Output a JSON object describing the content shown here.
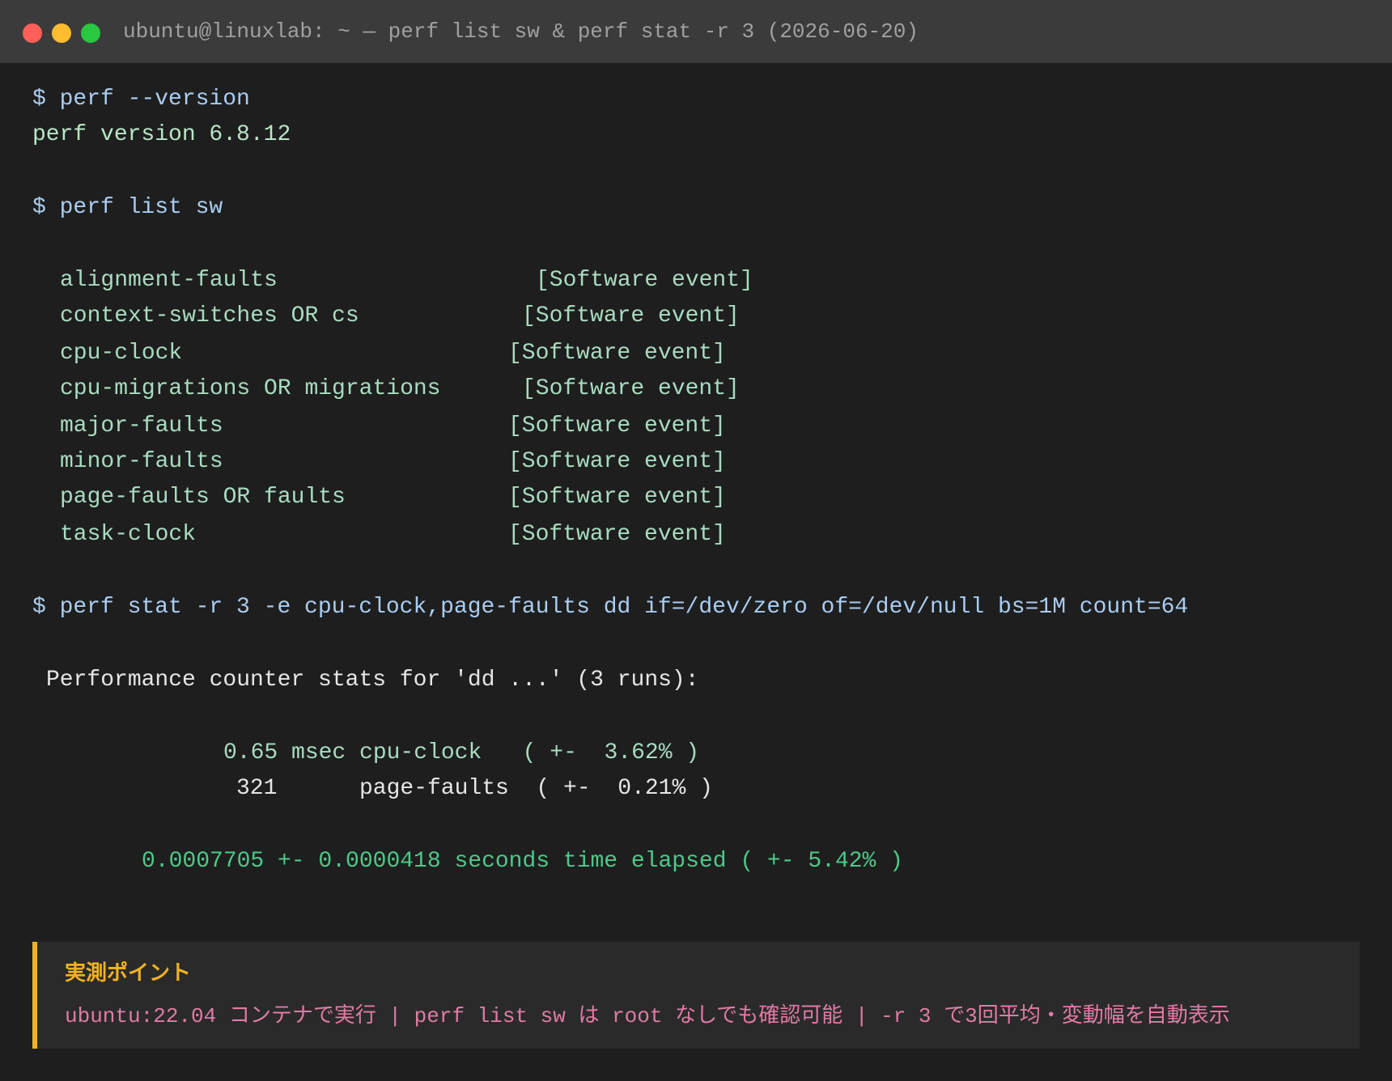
{
  "window": {
    "title": "ubuntu@linuxlab: ~ — perf list sw & perf stat -r 3 (2026-06-20)"
  },
  "terminal": {
    "cmd_version": "$ perf --version",
    "out_version": "perf version 6.8.12",
    "cmd_list": "$ perf list sw",
    "events": [
      {
        "name": "alignment-faults",
        "tag": "[Software event]"
      },
      {
        "name": "context-switches OR cs",
        "tag": "[Software event]"
      },
      {
        "name": "cpu-clock",
        "tag": "[Software event]"
      },
      {
        "name": "cpu-migrations OR migrations",
        "tag": "[Software event]"
      },
      {
        "name": "major-faults",
        "tag": "[Software event]"
      },
      {
        "name": "minor-faults",
        "tag": "[Software event]"
      },
      {
        "name": "page-faults OR faults",
        "tag": "[Software event]"
      },
      {
        "name": "task-clock",
        "tag": "[Software event]"
      }
    ],
    "cmd_stat": "$ perf stat -r 3 -e cpu-clock,page-faults dd if=/dev/zero of=/dev/null bs=1M count=64",
    "stats_header": "Performance counter stats for 'dd ...' (3 runs):",
    "stat_cpu": "0.65 msec cpu-clock   ( +-  3.62% )",
    "stat_pf_value": "321",
    "stat_pf_rest": "page-faults  ( +-  0.21% )",
    "elapsed": "0.0007705 +- 0.0000418 seconds time elapsed ( +- 5.42% )"
  },
  "note": {
    "title": "実測ポイント",
    "body": "ubuntu:22.04 コンテナで実行 | perf list sw は root なしでも確認可能 | -r 3 で3回平均・変動幅を自動表示"
  },
  "colors": {
    "background": "#1e1e1e",
    "titlebar": "#3b3b3b",
    "accent_note": "#f2b320",
    "note_text": "#e07ba6",
    "elapsed_green": "#4ec98a"
  }
}
